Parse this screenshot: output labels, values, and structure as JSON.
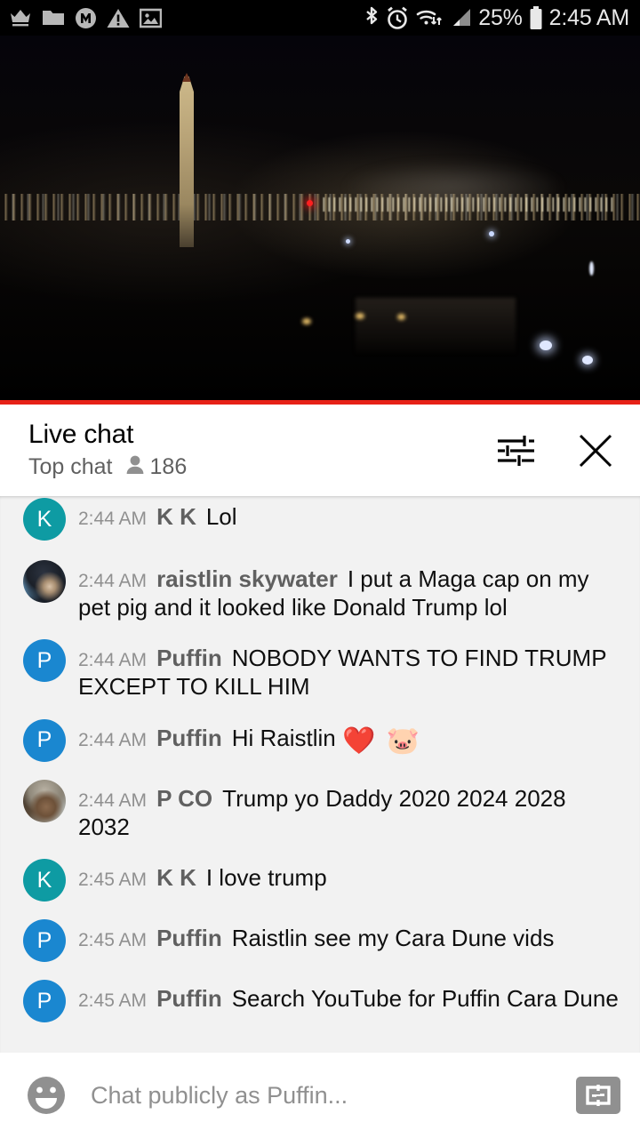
{
  "status_bar": {
    "left_icons": [
      "crown-icon",
      "folder-icon",
      "messenger-m-icon",
      "warning-triangle-icon",
      "image-icon"
    ],
    "right_icons": [
      "bluetooth-icon",
      "alarm-clock-icon",
      "wifi-icon",
      "cell-signal-icon",
      "battery-icon"
    ],
    "battery_percent": "25%",
    "clock": "2:45 AM"
  },
  "video": {
    "scene_description": "Washington Monument at night",
    "live_indicator_color": "#e62117"
  },
  "chat_header": {
    "title": "Live chat",
    "mode": "Top chat",
    "viewer_count": "186",
    "settings_icon": "tune-sliders-icon",
    "close_icon": "close-icon"
  },
  "messages": [
    {
      "time": "2:44 AM",
      "author": "K K",
      "text": "Lol",
      "avatar_kind": "initial",
      "avatar_initial": "K",
      "avatar_color": "#0e9ba3",
      "partial": true
    },
    {
      "time": "2:44 AM",
      "author": "raistlin skywater",
      "text": "I put a Maga cap on my pet pig and it looked like Donald Trump lol",
      "avatar_kind": "photo-raistlin",
      "avatar_initial": "",
      "avatar_color": "#4a6f8e",
      "partial": false
    },
    {
      "time": "2:44 AM",
      "author": "Puffin",
      "text": "NOBODY WANTS TO FIND TRUMP EXCEPT TO KILL HIM",
      "avatar_kind": "initial",
      "avatar_initial": "P",
      "avatar_color": "#1a87d0",
      "partial": false
    },
    {
      "time": "2:44 AM",
      "author": "Puffin",
      "text": "Hi Raistlin ",
      "emoji": "❤️ 🐷",
      "avatar_kind": "initial",
      "avatar_initial": "P",
      "avatar_color": "#1a87d0",
      "partial": false
    },
    {
      "time": "2:44 AM",
      "author": "P CO",
      "text": "Trump yo Daddy 2020 2024 2028 2032",
      "avatar_kind": "photo-pco",
      "avatar_initial": "",
      "avatar_color": "#6d5139",
      "partial": false
    },
    {
      "time": "2:45 AM",
      "author": "K K",
      "text": "I love trump",
      "avatar_kind": "initial",
      "avatar_initial": "K",
      "avatar_color": "#0e9ba3",
      "partial": false
    },
    {
      "time": "2:45 AM",
      "author": "Puffin",
      "text": "Raistlin see my Cara Dune vids",
      "avatar_kind": "initial",
      "avatar_initial": "P",
      "avatar_color": "#1a87d0",
      "partial": false
    },
    {
      "time": "2:45 AM",
      "author": "Puffin",
      "text": "Search YouTube for Puffin Cara Dune",
      "avatar_kind": "initial",
      "avatar_initial": "P",
      "avatar_color": "#1a87d0",
      "partial": false
    }
  ],
  "input_bar": {
    "emoji_icon": "emoji-face-icon",
    "placeholder": "Chat publicly as Puffin...",
    "value": "",
    "superchat_icon": "dollar-bill-icon"
  }
}
